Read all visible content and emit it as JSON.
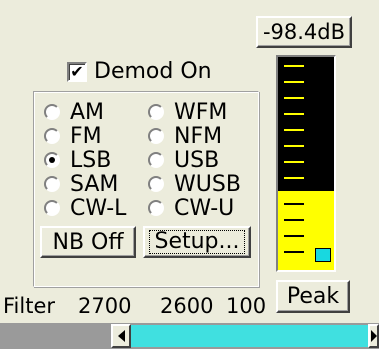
{
  "level_readout": "-98.4dB",
  "demod": {
    "label": "Demod On",
    "checked": true
  },
  "modes": [
    {
      "label": "AM",
      "selected": false
    },
    {
      "label": "WFM",
      "selected": false
    },
    {
      "label": "FM",
      "selected": false
    },
    {
      "label": "NFM",
      "selected": false
    },
    {
      "label": "LSB",
      "selected": true
    },
    {
      "label": "USB",
      "selected": false
    },
    {
      "label": "SAM",
      "selected": false
    },
    {
      "label": "WUSB",
      "selected": false
    },
    {
      "label": "CW-L",
      "selected": false
    },
    {
      "label": "CW-U",
      "selected": false
    }
  ],
  "buttons": {
    "nb": "NB Off",
    "setup": "Setup...",
    "peak": "Peak"
  },
  "filter": {
    "label": "Filter",
    "values": [
      "2700",
      "2600",
      "100"
    ]
  },
  "meter": {
    "level_fraction": 0.37,
    "fill_color": "#ffff00",
    "peak_color": "#18d8e0"
  },
  "colors": {
    "background": "#ececdc",
    "scroll_thumb": "#40e0e0"
  }
}
